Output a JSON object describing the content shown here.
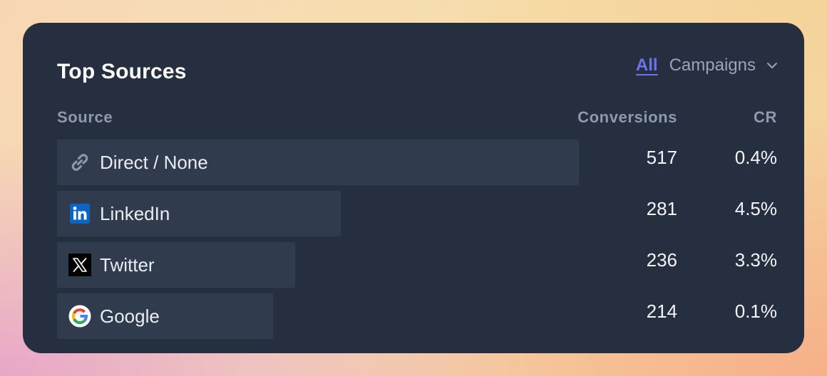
{
  "card": {
    "title": "Top Sources"
  },
  "filters": {
    "all_label": "All",
    "campaigns_label": "Campaigns"
  },
  "columns": {
    "source": "Source",
    "conversions": "Conversions",
    "cr": "CR"
  },
  "rows": [
    {
      "label": "Direct / None",
      "icon": "link-icon",
      "conversions": "517",
      "cr": "0.4%",
      "share": 1.0
    },
    {
      "label": "LinkedIn",
      "icon": "linkedin-icon",
      "conversions": "281",
      "cr": "4.5%",
      "share": 0.544
    },
    {
      "label": "Twitter",
      "icon": "x-twitter-icon",
      "conversions": "236",
      "cr": "3.3%",
      "share": 0.456
    },
    {
      "label": "Google",
      "icon": "google-icon",
      "conversions": "214",
      "cr": "0.1%",
      "share": 0.414
    }
  ],
  "colors": {
    "card_bg": "#262f40",
    "bar_bg": "#303b4d",
    "accent": "#6f72f0",
    "muted": "#8e99ad"
  }
}
